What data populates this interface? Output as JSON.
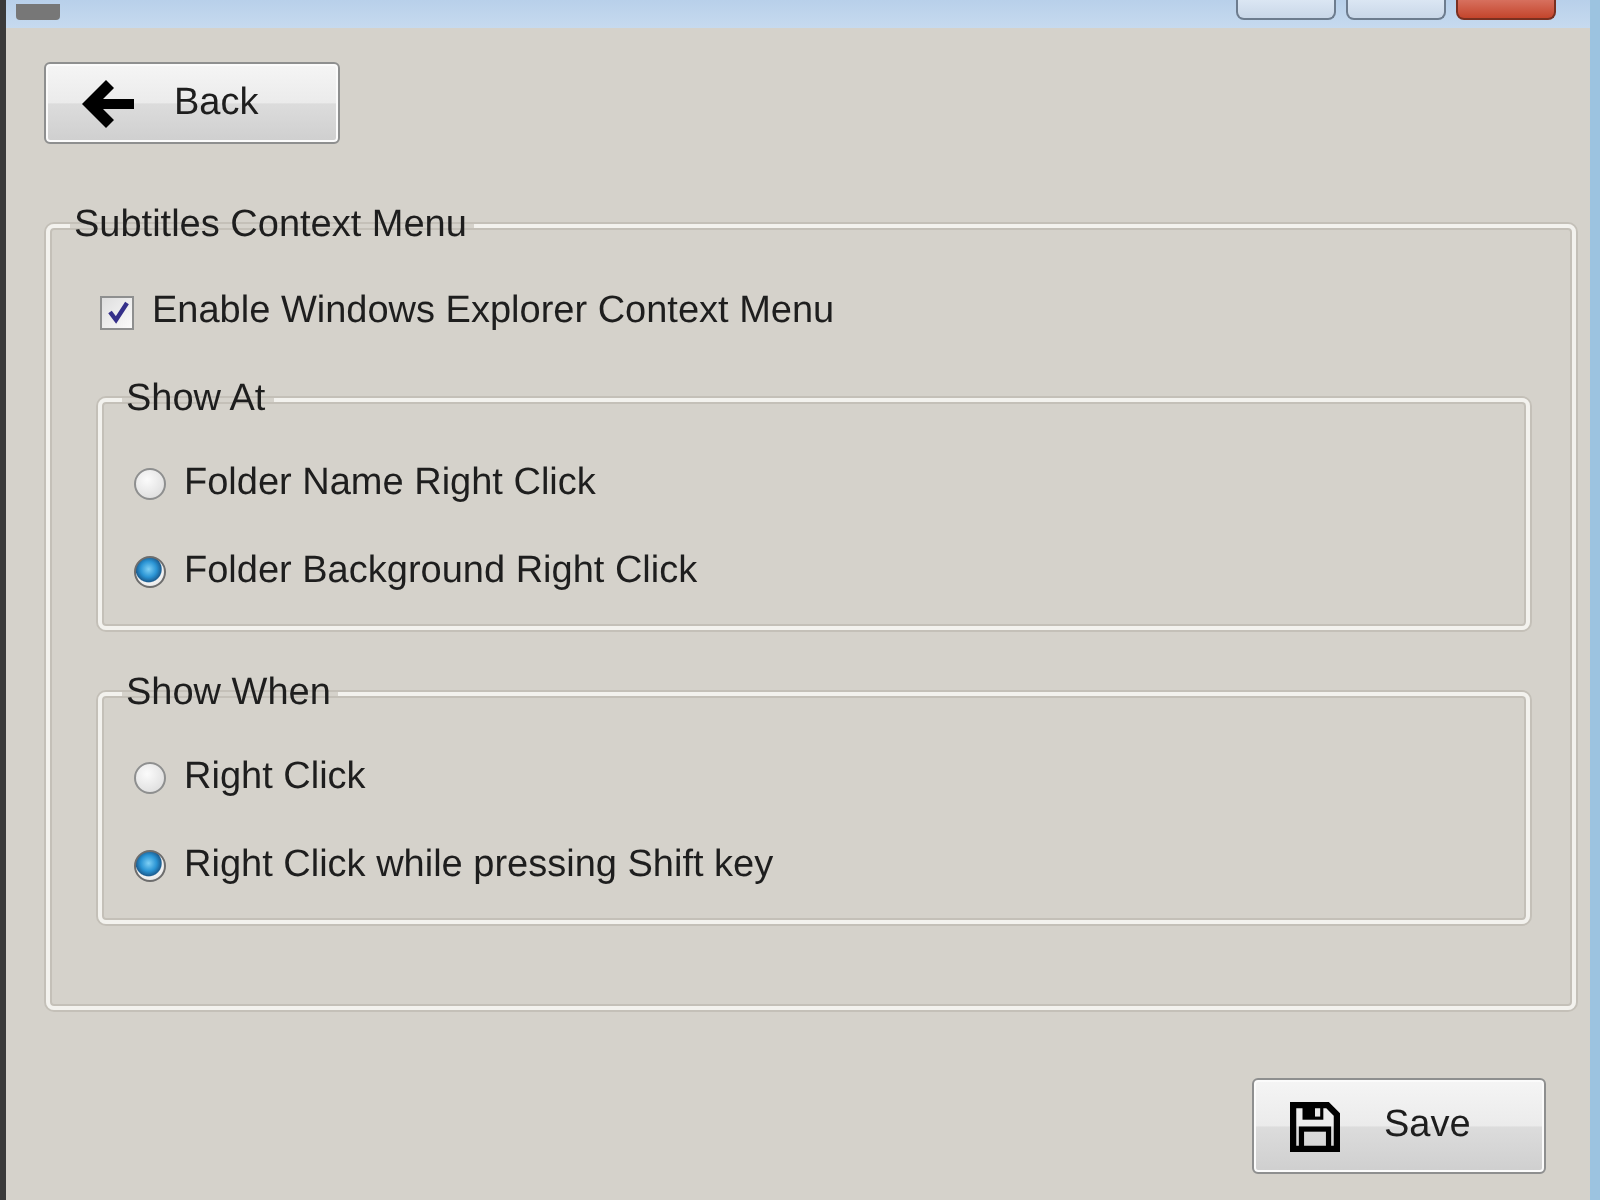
{
  "back_button": {
    "label": "Back"
  },
  "group": {
    "title": "Subtitles Context Menu",
    "checkbox": {
      "label": "Enable Windows Explorer Context Menu",
      "checked": true
    },
    "subgroups": [
      {
        "title": "Show At",
        "options": [
          {
            "label": "Folder Name Right Click",
            "selected": false
          },
          {
            "label": "Folder Background Right Click",
            "selected": true
          }
        ]
      },
      {
        "title": "Show When",
        "options": [
          {
            "label": "Right Click",
            "selected": false
          },
          {
            "label": "Right Click while pressing Shift key",
            "selected": true
          }
        ]
      }
    ]
  },
  "save_button": {
    "label": "Save"
  }
}
